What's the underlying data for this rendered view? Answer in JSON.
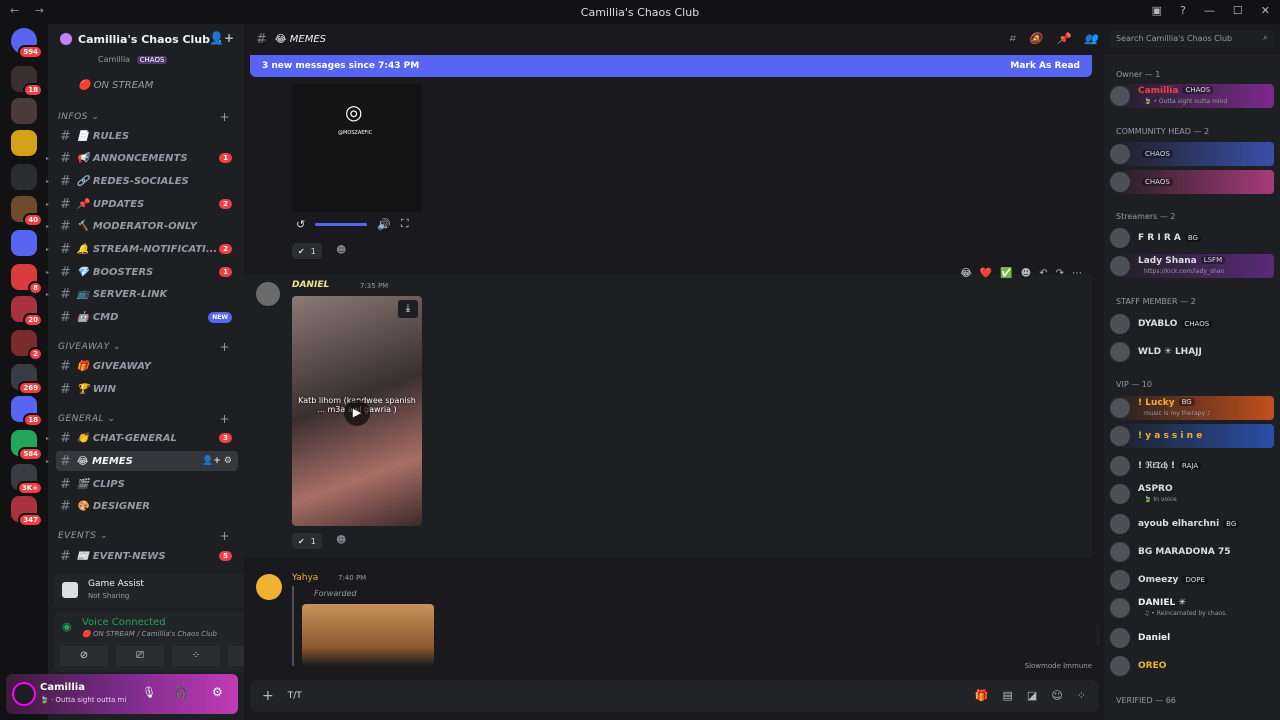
{
  "window": {
    "title": "Camillia's Chaos Club",
    "nav": "← →"
  },
  "guild": {
    "name": "Camillia's Chaos Club ⌄"
  },
  "servers": [
    {
      "badge": "594"
    },
    {
      "badge": "18"
    },
    {
      "badge": ""
    },
    {
      "badge": ""
    },
    {
      "badge": ""
    },
    {
      "badge": "40"
    },
    {
      "badge": ""
    },
    {
      "badge": "8"
    },
    {
      "badge": "20"
    },
    {
      "badge": "2"
    },
    {
      "badge": "269"
    },
    {
      "badge": "18"
    },
    {
      "badge": "584"
    },
    {
      "badge": "3K+"
    },
    {
      "badge": "347"
    }
  ],
  "channels": {
    "top_user": "Camillia",
    "top_user_tag": "CHAOS",
    "on_stream": "🔴 ON STREAM",
    "categories": {
      "infos": "INFOS ⌄",
      "giveaway": "GIVEAWAY ⌄",
      "general": "GENERAL ⌄",
      "events": "EVENTS ⌄"
    },
    "items": [
      {
        "label": "📄 RULES",
        "badge": ""
      },
      {
        "label": "📢 ANNONCEMENTS",
        "badge": "1"
      },
      {
        "label": "🔗 REDES-SOCIALES",
        "badge": ""
      },
      {
        "label": "📌 UPDATES",
        "badge": "2"
      },
      {
        "label": "🔨 MODERATOR-ONLY",
        "badge": ""
      },
      {
        "label": "🔔 STREAM-NOTIFICATI...",
        "badge": "2"
      },
      {
        "label": "💎 BOOSTERS",
        "badge": "1"
      },
      {
        "label": "📺 SERVER-LINK",
        "badge": ""
      },
      {
        "label": "🤖 CMD",
        "badge": "NEW"
      },
      {
        "label": "🎁 GIVEAWAY",
        "badge": ""
      },
      {
        "label": "🏆 WIN",
        "badge": ""
      },
      {
        "label": "👏 CHAT-GENERAL",
        "badge": "3"
      },
      {
        "label": "😂 MEMES",
        "badge": ""
      },
      {
        "label": "🎬 CLIPS",
        "badge": ""
      },
      {
        "label": "🎨 DESIGNER",
        "badge": ""
      },
      {
        "label": "📰 EVENT-NEWS",
        "badge": "5"
      }
    ]
  },
  "game_assist": {
    "title": "Game Assist",
    "sub": "Not Sharing"
  },
  "voice": {
    "title": "Voice Connected",
    "sub": "🔴 ON STREAM / Camillia's Chaos Club"
  },
  "user": {
    "name": "Camillia",
    "status": "🍃 · Outta sight outta mi"
  },
  "header": {
    "channel": "😂 MEMES"
  },
  "banner": {
    "text": "3 new messages since 7:43 PM",
    "action": "Mark As Read"
  },
  "messages": [
    {
      "reaction_count": "1"
    },
    {
      "author": "DANIEL",
      "time": "7:35 PM",
      "video_caption": "Katb lihom (kandwee spanish ... m3a awl gawria )",
      "reaction_count": "1"
    },
    {
      "author": "Yahya",
      "time": "7:40 PM",
      "forwarded": "Forwarded"
    }
  ],
  "video_top_caption": "@MOSZAEFIC",
  "composer": {
    "text": "T/T",
    "slowmode": "Slowmode Immune"
  },
  "search": {
    "placeholder": "Search Camillia's Chaos Club"
  },
  "members": {
    "groups": [
      {
        "title": "Owner — 1"
      },
      {
        "title": "COMMUNITY HEAD — 2"
      },
      {
        "title": "Streamers — 2"
      },
      {
        "title": "STAFF MEMBER — 2"
      },
      {
        "title": "VIP — 10"
      },
      {
        "title": "VERIFIED — 66"
      }
    ],
    "list": [
      {
        "name": "Camillia",
        "tag": "CHAOS",
        "sub": "🍃 • Outta sight outta mind",
        "color": "#f23f43"
      },
      {
        "name": "",
        "tag": "CHAOS",
        "sub": "",
        "color": "#dbdee1"
      },
      {
        "name": "",
        "tag": "CHAOS",
        "sub": "",
        "color": "#dbdee1"
      },
      {
        "name": "F R I R A",
        "tag": "BG",
        "sub": "",
        "color": "#dbdee1"
      },
      {
        "name": "Lady Shana",
        "tag": "LSFM",
        "sub": "https://kick.com/lady_shan",
        "color": "#dbdee1"
      },
      {
        "name": "DYABLO",
        "tag": "CHAOS",
        "sub": "",
        "color": "#dbdee1"
      },
      {
        "name": "WLD ✳ LHAJJ",
        "tag": "",
        "sub": "",
        "color": "#dbdee1"
      },
      {
        "name": "! Lucky",
        "tag": "BG",
        "sub": "music is my therapy ♪",
        "color": "#f0b232"
      },
      {
        "name": "! y a s s i n e",
        "tag": "",
        "sub": "",
        "color": "#f0b232"
      },
      {
        "name": "! ℜ𝔦𝔗𝔠𝔥 !",
        "tag": "RAJA",
        "sub": "",
        "color": "#dbdee1"
      },
      {
        "name": "ASPRO",
        "tag": "",
        "sub": "🍃 In voice",
        "color": "#dbdee1"
      },
      {
        "name": "ayoub elharchni",
        "tag": "BG",
        "sub": "",
        "color": "#dbdee1"
      },
      {
        "name": "BG MARADONA 75",
        "tag": "",
        "sub": "",
        "color": "#dbdee1"
      },
      {
        "name": "Omeezy",
        "tag": "DOPE",
        "sub": "",
        "color": "#dbdee1"
      },
      {
        "name": "DANIEL ✳",
        "tag": "",
        "sub": "♫ • Reincarnated by chaos.",
        "color": "#f2f3f5"
      },
      {
        "name": "Daniel",
        "tag": "",
        "sub": "",
        "color": "#f2f3f5"
      },
      {
        "name": "OREO",
        "tag": "",
        "sub": "",
        "color": "#f0b232"
      }
    ]
  }
}
